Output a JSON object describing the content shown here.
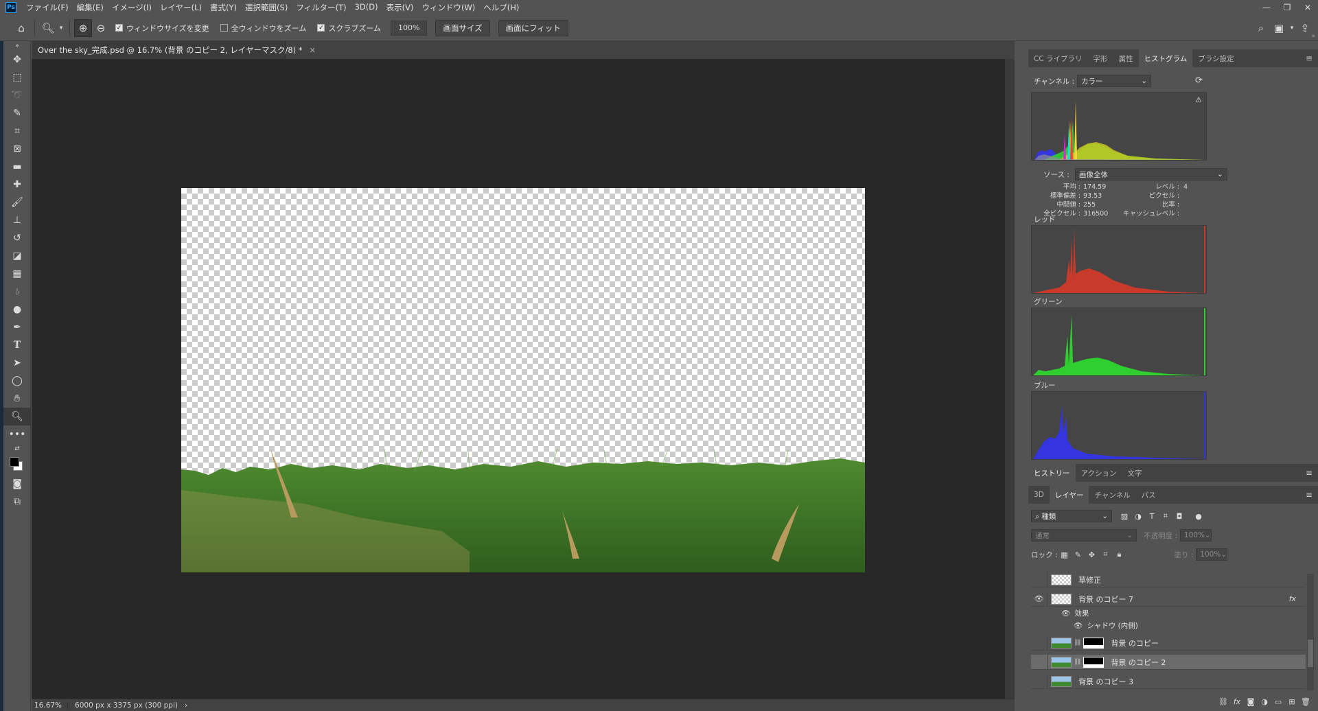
{
  "menu": {
    "logo": "Ps",
    "items": [
      "ファイル(F)",
      "編集(E)",
      "イメージ(I)",
      "レイヤー(L)",
      "書式(Y)",
      "選択範囲(S)",
      "フィルター(T)",
      "3D(D)",
      "表示(V)",
      "ウィンドウ(W)",
      "ヘルプ(H)"
    ]
  },
  "options": {
    "resize_windows": "ウィンドウサイズを変更",
    "zoom_all": "全ウィンドウをズーム",
    "scrubby_zoom": "スクラブズーム",
    "zoom_value": "100%",
    "fit_screen": "画面サイズ",
    "fill_screen": "画面にフィット"
  },
  "document": {
    "tab_title": "Over the sky_完成.psd @ 16.7% (背景 のコピー 2, レイヤーマスク/8) *",
    "zoom": "16.67%",
    "info": "6000 px x 3375 px (300 ppi)"
  },
  "top_panel": {
    "tabs": [
      "CC ライブラリ",
      "字形",
      "属性",
      "ヒストグラム",
      "ブラシ設定"
    ],
    "active_tab": 3,
    "channel_label": "チャンネル :",
    "channel_value": "カラー",
    "source_label": "ソース :",
    "source_value": "画像全体",
    "stats_left": {
      "labels": [
        "平均 :",
        "標準偏差 :",
        "中間値 :",
        "全ピクセル :"
      ],
      "values": [
        "174.59",
        "93.53",
        "255",
        "316500"
      ]
    },
    "stats_right": {
      "labels": [
        "レベル :",
        "ピクセル :",
        "比率 :",
        "キャッシュレベル :"
      ],
      "values": [
        "",
        "",
        "",
        "4"
      ]
    },
    "labels": {
      "red": "レッド",
      "green": "グリーン",
      "blue": "ブルー"
    }
  },
  "history_panel": {
    "tabs": [
      "ヒストリー",
      "アクション",
      "文字"
    ]
  },
  "layers_panel": {
    "tabs": [
      "3D",
      "レイヤー",
      "チャンネル",
      "パス"
    ],
    "active_tab": 1,
    "filter_kind": "種類",
    "blend_mode": "通常",
    "opacity_label": "不透明度 :",
    "opacity_value": "100%",
    "lock_label": "ロック :",
    "fill_label": "塗り :",
    "fill_value": "100%",
    "layers": [
      {
        "name": "草修正",
        "visible": false,
        "thumb": "transparent",
        "mask": false,
        "selected": false
      },
      {
        "name": "背景 のコピー 7",
        "visible": true,
        "thumb": "transparent",
        "mask": false,
        "selected": false,
        "fx": "fx"
      },
      {
        "name": "背景 のコピー",
        "visible": false,
        "thumb": "image",
        "mask": true,
        "selected": false
      },
      {
        "name": "背景 のコピー 2",
        "visible": false,
        "thumb": "image",
        "mask": true,
        "selected": true
      },
      {
        "name": "背景 のコピー 3",
        "visible": false,
        "thumb": "image",
        "mask": false,
        "selected": false
      }
    ],
    "effects_label": "効果",
    "effect_item": "シャドウ (内側)"
  },
  "colors": {
    "ui_bg": "#535353",
    "canvas_bg": "#282828",
    "hist_red": "#c83a2a",
    "hist_green": "#2fcf2f",
    "hist_blue": "#3535e0"
  }
}
